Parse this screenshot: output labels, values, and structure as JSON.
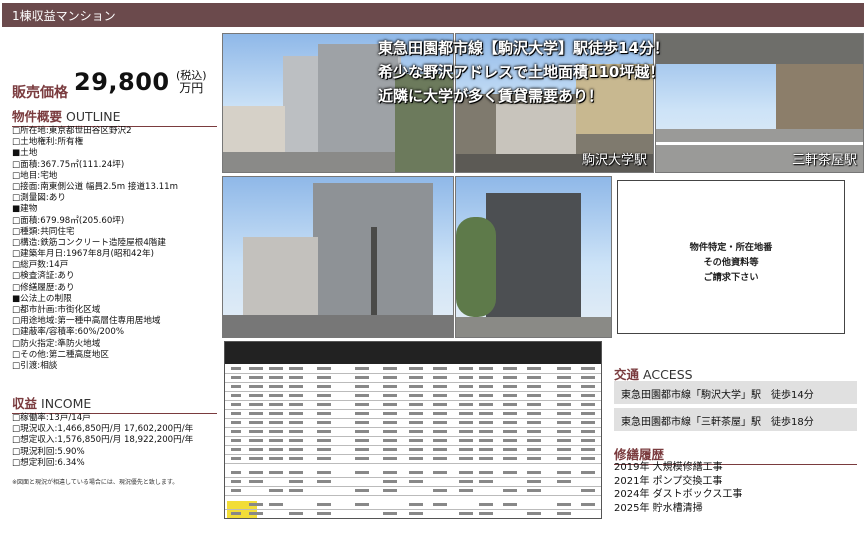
{
  "header": {
    "title": "1棟収益マンション"
  },
  "price": {
    "label": "販売価格",
    "value": "29,800",
    "tax": "(税込)",
    "unit": "万円"
  },
  "outline": {
    "heading": "物件概要",
    "heading_en": "OUTLINE",
    "lines": [
      "□所在地:東京都世田谷区野沢2",
      "□土地権利:所有権",
      "■土地",
      "□面積:367.75㎡(111.24坪)",
      "□地目:宅地",
      "□接面:南東側公道 幅員2.5m 接道13.11m",
      "□測量図:あり",
      "■建物",
      "□面積:679.98㎡(205.60坪)",
      "□種類:共同住宅",
      "□構造:鉄筋コンクリート造陸屋根4階建",
      "□建築年月日:1967年8月(昭和42年)",
      "□総戸数:14戸",
      "□検査済証:あり",
      "□修繕履歴:あり",
      "■公法上の制限",
      "□都市計画:市街化区域",
      "□用途地域:第一種中高層住専用居地域",
      "□建蔽率/容積率:60%/200%",
      "□防火指定:準防火地域",
      "□その他:第二種高度地区",
      "□引渡:相談"
    ]
  },
  "income": {
    "heading": "収益",
    "heading_en": "INCOME",
    "lines": [
      "□稼働率:13戸/14戸",
      "□現況収入:1,466,850円/月 17,602,200円/年",
      "□想定収入:1,576,850円/月 18,922,200円/年",
      "□現況利回:5.90%",
      "□想定利回:6.34%"
    ],
    "note": "※図面と現況が相違している場合には、現況優先と致します。"
  },
  "photos": {
    "headline": [
      "東急田園都市線【駒沢大学】駅徒歩14分！",
      "希少な野沢アドレスで土地面積110坪越！",
      "近隣に大学が多く賃貸需要あり！"
    ],
    "caption_station1": "駒沢大学駅",
    "caption_station2": "三軒茶屋駅"
  },
  "request_box": {
    "lines": [
      "物件特定・所在地番",
      "その他資料等",
      "ご請求下さい"
    ]
  },
  "access": {
    "heading": "交通",
    "heading_en": "ACCESS",
    "routes": [
      "東急田園都市線「駒沢大学」駅　徒歩14分",
      "東急田園都市線「三軒茶屋」駅　徒歩18分"
    ]
  },
  "repairs": {
    "heading": "修繕履歴",
    "items": [
      "2019年 大規模修繕工事",
      "2021年 ポンプ交換工事",
      "2024年 ダストボックス工事",
      "2025年 貯水槽清掃"
    ]
  }
}
